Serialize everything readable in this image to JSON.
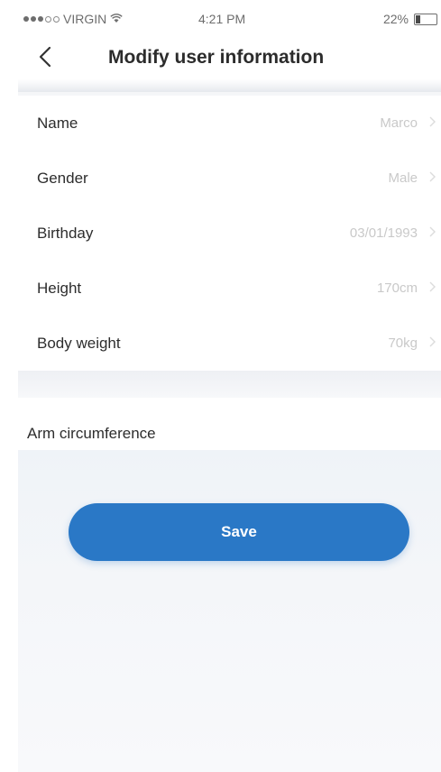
{
  "status_bar": {
    "carrier": "VIRGIN",
    "time": "4:21 PM",
    "battery_percent": "22%",
    "battery_level": 0.22,
    "signal_dots_filled": 3,
    "signal_dots_total": 5
  },
  "nav": {
    "title": "Modify user information",
    "back_icon": "chevron-left-icon"
  },
  "fields": [
    {
      "label": "Name",
      "value": "Marco"
    },
    {
      "label": "Gender",
      "value": "Male"
    },
    {
      "label": "Birthday",
      "value": "03/01/1993"
    },
    {
      "label": "Height",
      "value": "170cm"
    },
    {
      "label": "Body weight",
      "value": "70kg"
    }
  ],
  "arm": {
    "label": "Arm circumference"
  },
  "save": {
    "label": "Save"
  },
  "colors": {
    "accent": "#2a78c6",
    "value_text": "#c9c9c9",
    "label_text": "#2d2d2d"
  }
}
